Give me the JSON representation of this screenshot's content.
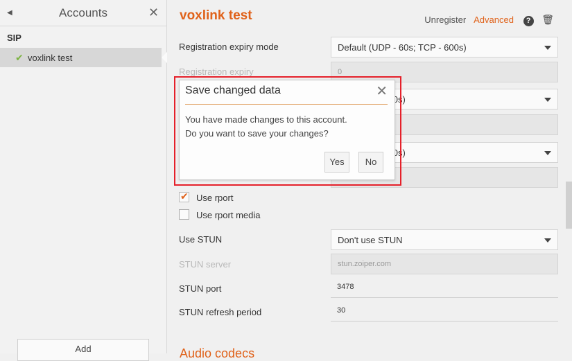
{
  "sidebar": {
    "title": "Accounts",
    "section": "SIP",
    "account_label": "voxlink test",
    "add_label": "Add"
  },
  "header": {
    "account_title": "voxlink test",
    "unregister": "Unregister",
    "advanced": "Advanced"
  },
  "form": {
    "reg_expiry_mode_label": "Registration expiry mode",
    "reg_expiry_mode_value": "Default (UDP - 60s; TCP - 600s)",
    "reg_expiry_label": "Registration expiry",
    "reg_expiry_value": "0",
    "row3_value": "60s; TCP - 600s)",
    "row5_value": "30s; TCP - 180s)",
    "use_rport": "Use rport",
    "use_rport_media": "Use rport media",
    "use_stun_label": "Use STUN",
    "use_stun_value": "Don't use STUN",
    "stun_server_label": "STUN server",
    "stun_server_placeholder": "stun.zoiper.com",
    "stun_port_label": "STUN port",
    "stun_port_value": "3478",
    "stun_refresh_label": "STUN refresh period",
    "stun_refresh_value": "30",
    "next_section_title": "Audio codecs"
  },
  "dialog": {
    "title": "Save changed data",
    "line1": "You have made changes to this account.",
    "line2": "Do you want to save your changes?",
    "yes": "Yes",
    "no": "No"
  },
  "colors": {
    "accent": "#e0621a",
    "highlight": "#e5202a",
    "check": "#7cb342"
  }
}
